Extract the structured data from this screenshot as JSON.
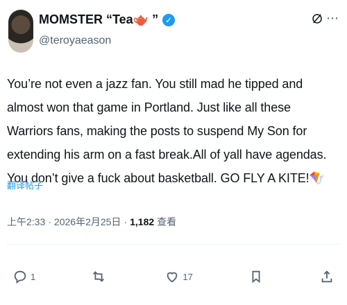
{
  "user": {
    "display_name": "MOMSTER “Tea🫖 ”",
    "handle": "@teroyaeason",
    "verified": true
  },
  "tweet": {
    "text": "You’re not even a jazz fan. You still mad he tipped and almost won that game in Portland. Just like all these Warriors fans, making the posts to suspend My Son for extending his arm on a fast break.All of yall have agendas. You don’t give a fuck about basketball. GO FLY A KITE!🪁",
    "translate_label": "翻译帖子",
    "time": "上午2:33",
    "date": "2026年2月25日",
    "views": "1,182",
    "views_label": "查看"
  },
  "actions": {
    "reply_count": "1",
    "repost_count": "",
    "like_count": "17"
  },
  "colors": {
    "accent": "#1d9bf0",
    "muted": "#536471",
    "text": "#0f1419"
  }
}
